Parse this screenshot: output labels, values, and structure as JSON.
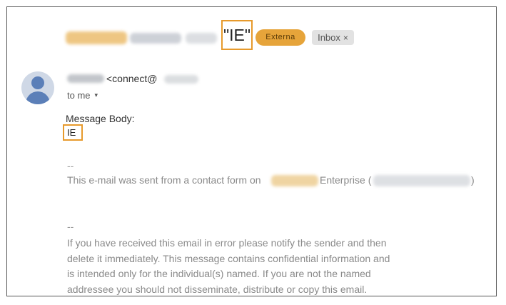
{
  "subject": {
    "highlighted_text": "\"IE\"",
    "labels": {
      "external": "Externa",
      "inbox": "Inbox",
      "inbox_close": "×"
    }
  },
  "sender": {
    "email_fragment": "<connect@",
    "recipient": "to me",
    "recipient_caret": "▾"
  },
  "body": {
    "label": "Message Body:",
    "value": "IE"
  },
  "signature": {
    "separator_1": "--",
    "sent_from_prefix": "This e-mail was sent from a contact form on",
    "sent_from_mid": "Enterprise (",
    "sent_from_suffix": ")",
    "separator_2": "--",
    "disclaimer_lines": [
      "If you have received this email in error please notify the sender and then",
      "delete it immediately. This message contains confidential information and",
      "is intended only for the individual(s) named. If you are not the named",
      "addressee you should not disseminate, distribute or copy this email."
    ]
  },
  "colors": {
    "highlight_box": "#e79a2c",
    "external_label": "#e6a43a",
    "inbox_label": "#e2e2e2",
    "avatar": "#5b7fb8"
  },
  "icons": {
    "avatar": "person-avatar-icon",
    "caret": "chevron-down-icon",
    "close": "close-icon"
  }
}
